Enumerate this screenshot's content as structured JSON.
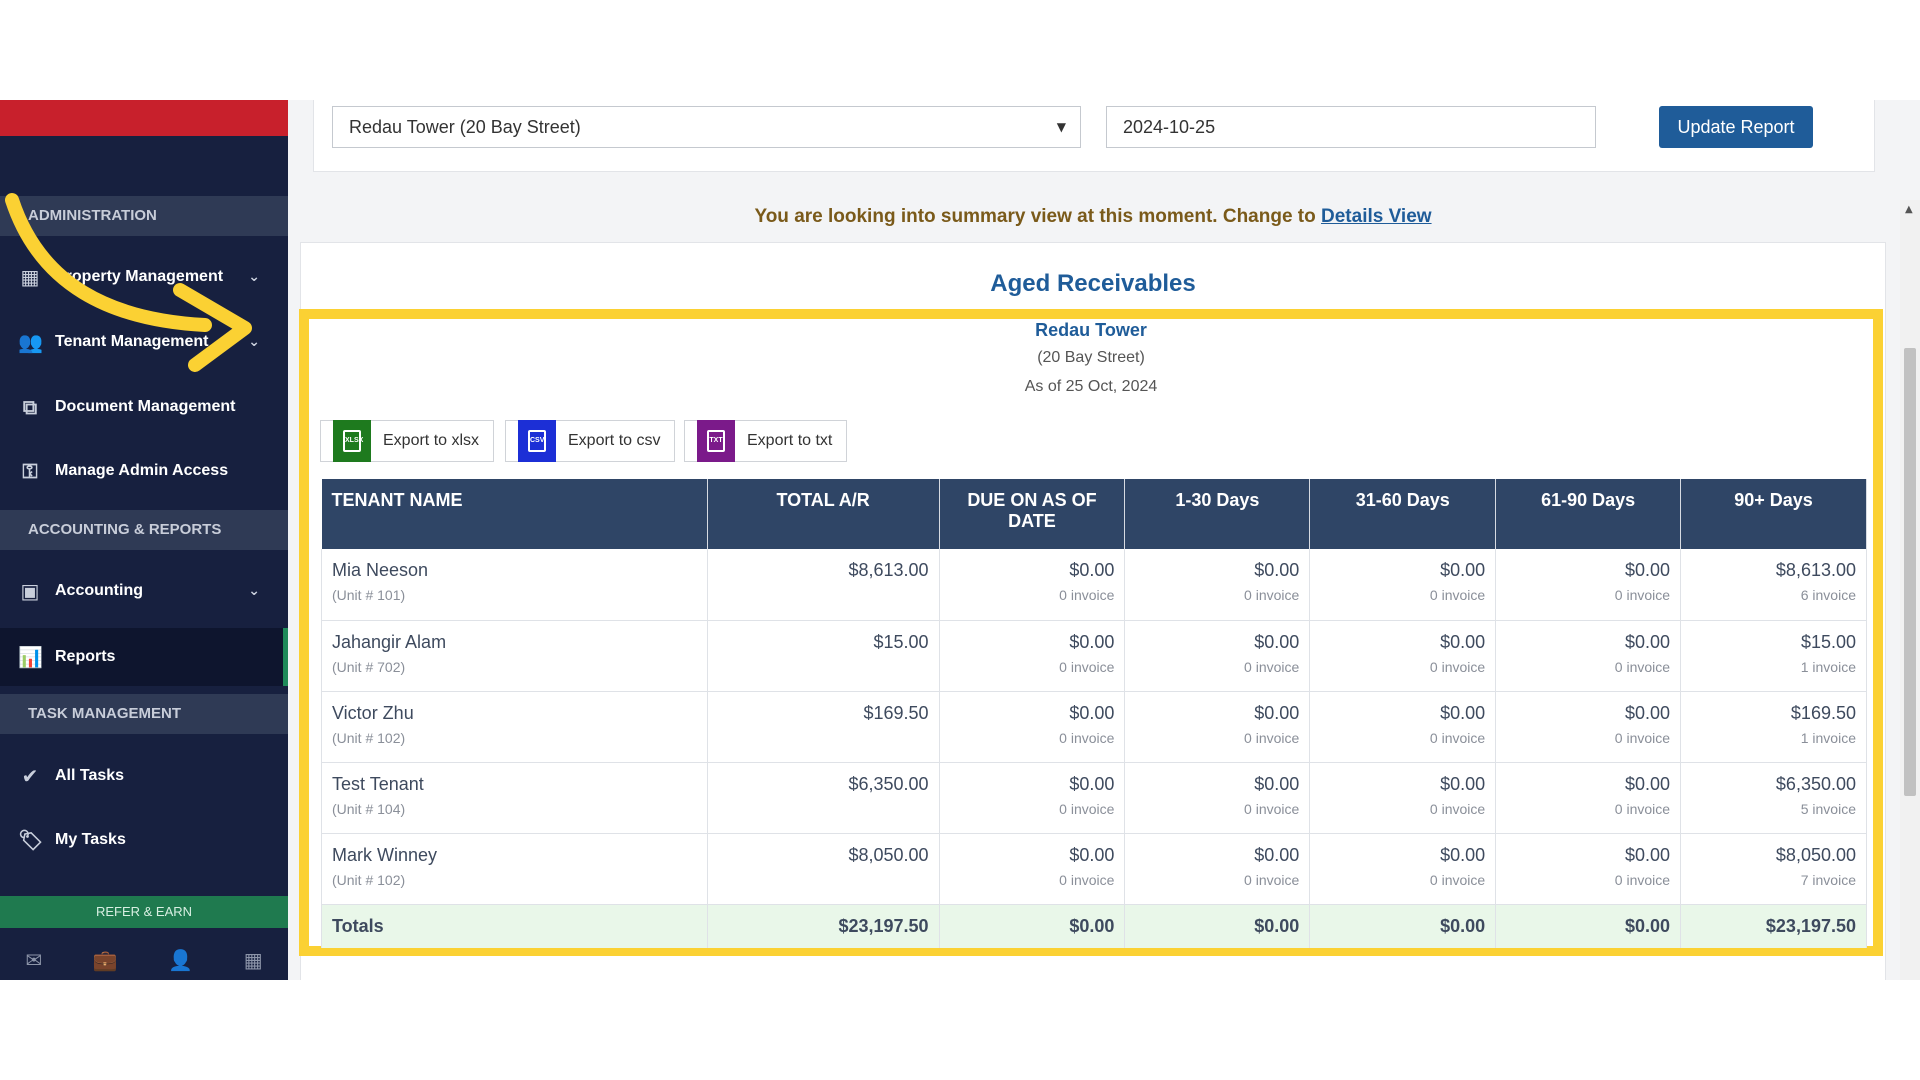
{
  "sidebar": {
    "sections": {
      "administration": "ADMINISTRATION",
      "accounting": "ACCOUNTING & REPORTS",
      "tasks": "TASK MANAGEMENT"
    },
    "items": {
      "property": "Property Management",
      "tenant": "Tenant Management",
      "document": "Document Management",
      "admin_access": "Manage Admin Access",
      "accounting": "Accounting",
      "reports": "Reports",
      "all_tasks": "All Tasks",
      "my_tasks": "My Tasks"
    },
    "refer": "REFER & EARN"
  },
  "filters": {
    "property": "Redau Tower (20 Bay Street)",
    "date": "2024-10-25",
    "update_label": "Update Report"
  },
  "notice": {
    "text": "You are looking into summary view at this moment. Change to",
    "link": "Details View"
  },
  "report": {
    "title": "Aged Receivables",
    "building": "Redau Tower",
    "address": "(20 Bay Street)",
    "as_of": "As of 25 Oct, 2024",
    "exports": {
      "xlsx": "Export to xlsx",
      "csv": "Export to csv",
      "txt": "Export to txt",
      "xlsx_tag": "XLSX",
      "csv_tag": "CSV",
      "txt_tag": "TXT"
    },
    "columns": [
      "TENANT NAME",
      "TOTAL A/R",
      "DUE ON AS OF DATE",
      "1-30 Days",
      "31-60 Days",
      "61-90 Days",
      "90+ Days"
    ],
    "rows": [
      {
        "name": "Mia Neeson",
        "unit": "(Unit # 101)",
        "total": "$8,613.00",
        "due": "$0.00",
        "d1": "$0.00",
        "d2": "$0.00",
        "d3": "$0.00",
        "d4": "$8,613.00",
        "due_inv": "0 invoice",
        "d1_inv": "0 invoice",
        "d2_inv": "0 invoice",
        "d3_inv": "0 invoice",
        "d4_inv": "6 invoice"
      },
      {
        "name": "Jahangir Alam",
        "unit": "(Unit # 702)",
        "total": "$15.00",
        "due": "$0.00",
        "d1": "$0.00",
        "d2": "$0.00",
        "d3": "$0.00",
        "d4": "$15.00",
        "due_inv": "0 invoice",
        "d1_inv": "0 invoice",
        "d2_inv": "0 invoice",
        "d3_inv": "0 invoice",
        "d4_inv": "1 invoice"
      },
      {
        "name": "Victor Zhu",
        "unit": "(Unit # 102)",
        "total": "$169.50",
        "due": "$0.00",
        "d1": "$0.00",
        "d2": "$0.00",
        "d3": "$0.00",
        "d4": "$169.50",
        "due_inv": "0 invoice",
        "d1_inv": "0 invoice",
        "d2_inv": "0 invoice",
        "d3_inv": "0 invoice",
        "d4_inv": "1 invoice"
      },
      {
        "name": "Test Tenant",
        "unit": "(Unit # 104)",
        "total": "$6,350.00",
        "due": "$0.00",
        "d1": "$0.00",
        "d2": "$0.00",
        "d3": "$0.00",
        "d4": "$6,350.00",
        "due_inv": "0 invoice",
        "d1_inv": "0 invoice",
        "d2_inv": "0 invoice",
        "d3_inv": "0 invoice",
        "d4_inv": "5 invoice"
      },
      {
        "name": "Mark Winney",
        "unit": "(Unit # 102)",
        "total": "$8,050.00",
        "due": "$0.00",
        "d1": "$0.00",
        "d2": "$0.00",
        "d3": "$0.00",
        "d4": "$8,050.00",
        "due_inv": "0 invoice",
        "d1_inv": "0 invoice",
        "d2_inv": "0 invoice",
        "d3_inv": "0 invoice",
        "d4_inv": "7 invoice"
      }
    ],
    "totals": {
      "label": "Totals",
      "total": "$23,197.50",
      "due": "$0.00",
      "d1": "$0.00",
      "d2": "$0.00",
      "d3": "$0.00",
      "d4": "$23,197.50"
    }
  },
  "icons": {
    "property": "building-icon",
    "tenant": "users-icon",
    "document": "documents-icon",
    "admin_access": "key-icon",
    "accounting": "money-icon",
    "reports": "bar-chart-icon",
    "all_tasks": "check-icon",
    "my_tasks": "tag-icon"
  },
  "colors": {
    "sidebar": "#17203f",
    "accent_red": "#c8202c",
    "highlight": "#fbd133",
    "table_header": "#2f4566",
    "link_blue": "#1f5c99",
    "totals_bg": "#e9f7e9",
    "xlsx": "#1e7a1e",
    "csv": "#1c2fd6",
    "txt": "#7b1a8a"
  }
}
